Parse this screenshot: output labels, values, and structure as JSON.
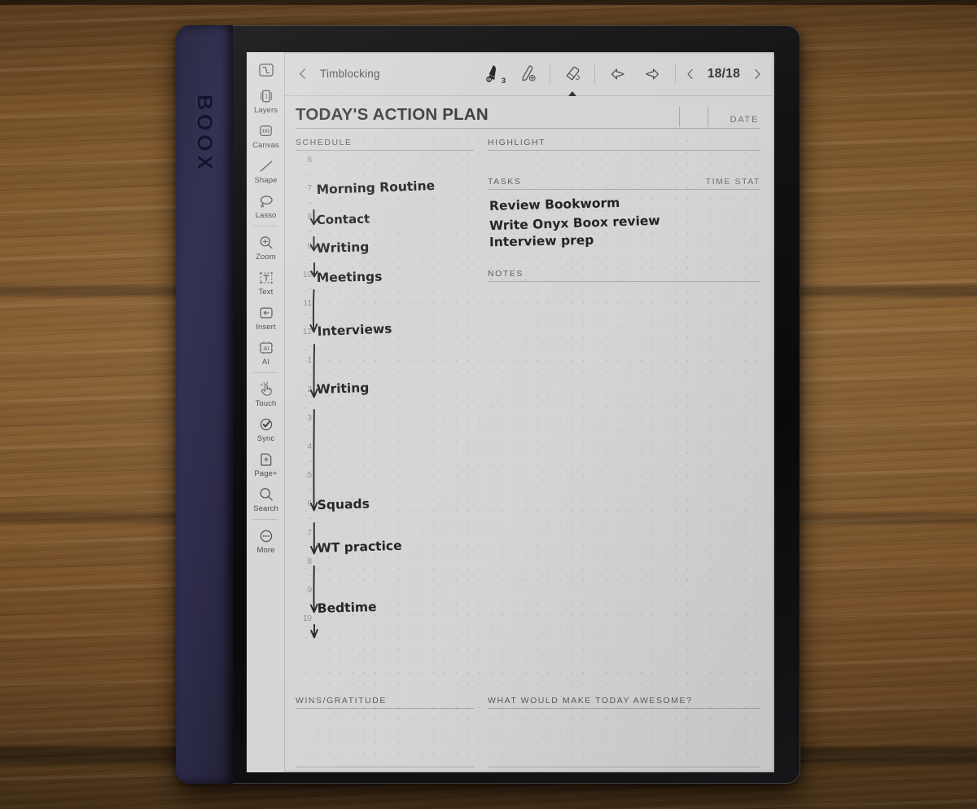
{
  "device": {
    "brand": "BOOX"
  },
  "topbar": {
    "back_icon": "chevron-left-icon",
    "doc_title": "Timblocking",
    "tools": [
      {
        "name": "pen-tool",
        "icon": "pen-icon",
        "badge": "3",
        "selected": true
      },
      {
        "name": "highlighter-tool",
        "icon": "highlighter-plus-icon",
        "badge": "",
        "selected": false
      },
      {
        "name": "eraser-tool",
        "icon": "eraser-icon",
        "badge": "",
        "selected": false
      }
    ],
    "undo_label": "undo-icon",
    "redo_label": "redo-icon",
    "prev_page_icon": "chevron-left-icon",
    "next_page_icon": "chevron-right-icon",
    "page_indicator": "18/18"
  },
  "sidebar": {
    "items": [
      {
        "label": "",
        "icon": "panel-collapse-icon"
      },
      {
        "label": "Layers",
        "icon": "layers-icon"
      },
      {
        "label": "Canvas",
        "icon": "canvas-1x1-icon"
      },
      {
        "label": "Shape",
        "icon": "line-shape-icon"
      },
      {
        "label": "Lasso",
        "icon": "lasso-icon"
      },
      {
        "label": "Zoom",
        "icon": "zoom-in-icon"
      },
      {
        "label": "Text",
        "icon": "text-box-icon"
      },
      {
        "label": "Insert",
        "icon": "insert-icon"
      },
      {
        "label": "AI",
        "icon": "ai-icon"
      },
      {
        "label": "Touch",
        "icon": "touch-hand-icon"
      },
      {
        "label": "Sync",
        "icon": "sync-check-icon"
      },
      {
        "label": "Page+",
        "icon": "add-page-icon"
      },
      {
        "label": "Search",
        "icon": "search-icon"
      },
      {
        "label": "More",
        "icon": "more-dots-icon"
      }
    ]
  },
  "planner": {
    "title": "TODAY'S ACTION PLAN",
    "date_label": "DATE",
    "schedule_label": "SCHEDULE",
    "highlight_label": "HIGHLIGHT",
    "tasks_label": "TASKS",
    "time_stat_label": "TIME STAT",
    "notes_label": "NOTES",
    "wins_label": "WINS/GRATITUDE",
    "awesome_label": "WHAT WOULD MAKE TODAY AWESOME?",
    "time_ticks": [
      "6",
      "7",
      "8",
      "9",
      "10",
      "11",
      "12",
      "1",
      "2",
      "3",
      "4",
      "5",
      "6",
      "7",
      "8",
      "9",
      "10"
    ],
    "half_tick": "-",
    "schedule_entries": [
      {
        "text": "Morning Routine",
        "hour": "7"
      },
      {
        "text": "Contact",
        "hour": "8"
      },
      {
        "text": "Writing",
        "hour": "9"
      },
      {
        "text": "Meetings",
        "hour": "10"
      },
      {
        "text": "Interviews",
        "hour": "11:30"
      },
      {
        "text": "Writing",
        "hour": "1:30"
      },
      {
        "text": "Squads",
        "hour": "5:30"
      },
      {
        "text": "WT practice",
        "hour": "7"
      },
      {
        "text": "Bedtime",
        "hour": "9"
      }
    ],
    "tasks": [
      "Review Bookworm",
      "Write Onyx Boox review",
      "Interview prep"
    ]
  },
  "colors": {
    "screen_bg": "#d4d5d3",
    "ink": "#202225",
    "rule": "#a9aaa8",
    "bezel": "#0f0e10",
    "grip": "#322f50",
    "wood": "#7a5429"
  }
}
